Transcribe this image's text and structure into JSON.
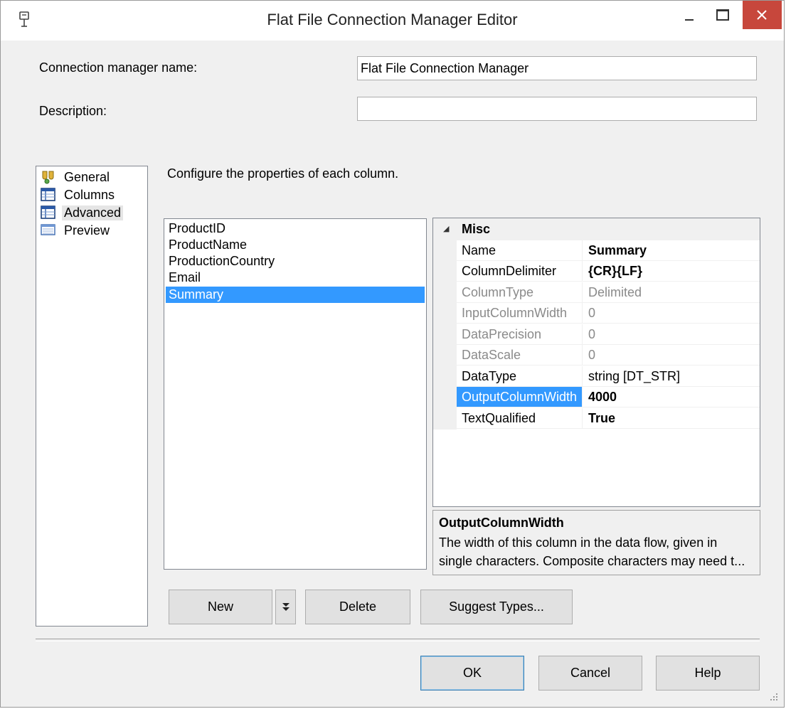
{
  "window": {
    "title": "Flat File Connection Manager Editor"
  },
  "form": {
    "name_label": "Connection manager name:",
    "name_value": "Flat File Connection Manager",
    "description_label": "Description:",
    "description_value": ""
  },
  "nav": {
    "items": [
      {
        "label": "General",
        "icon": "general-icon"
      },
      {
        "label": "Columns",
        "icon": "columns-icon"
      },
      {
        "label": "Advanced",
        "icon": "advanced-icon",
        "selected": true
      },
      {
        "label": "Preview",
        "icon": "preview-icon"
      }
    ]
  },
  "main": {
    "instruction": "Configure the properties of each column.",
    "columns": [
      "ProductID",
      "ProductName",
      "ProductionCountry",
      "Email",
      "Summary"
    ],
    "selected_column": "Summary"
  },
  "properties": {
    "category": "Misc",
    "rows": [
      {
        "name": "Name",
        "value": "Summary",
        "bold": true,
        "readonly": false
      },
      {
        "name": "ColumnDelimiter",
        "value": "{CR}{LF}",
        "bold": true,
        "readonly": false
      },
      {
        "name": "ColumnType",
        "value": "Delimited",
        "bold": false,
        "readonly": true
      },
      {
        "name": "InputColumnWidth",
        "value": "0",
        "bold": false,
        "readonly": true
      },
      {
        "name": "DataPrecision",
        "value": "0",
        "bold": false,
        "readonly": true
      },
      {
        "name": "DataScale",
        "value": "0",
        "bold": false,
        "readonly": true
      },
      {
        "name": "DataType",
        "value": "string [DT_STR]",
        "bold": false,
        "readonly": false
      },
      {
        "name": "OutputColumnWidth",
        "value": "4000",
        "bold": true,
        "readonly": false,
        "selected": true
      },
      {
        "name": "TextQualified",
        "value": "True",
        "bold": true,
        "readonly": false
      }
    ]
  },
  "help": {
    "title": "OutputColumnWidth",
    "text": "The width of this column in the data flow, given in single characters. Composite characters may need t..."
  },
  "buttons": {
    "new": "New",
    "delete": "Delete",
    "suggest": "Suggest Types...",
    "ok": "OK",
    "cancel": "Cancel",
    "help": "Help"
  },
  "colors": {
    "selection": "#3399ff",
    "close": "#c7473c",
    "dialog_bg": "#f0f0f0"
  }
}
